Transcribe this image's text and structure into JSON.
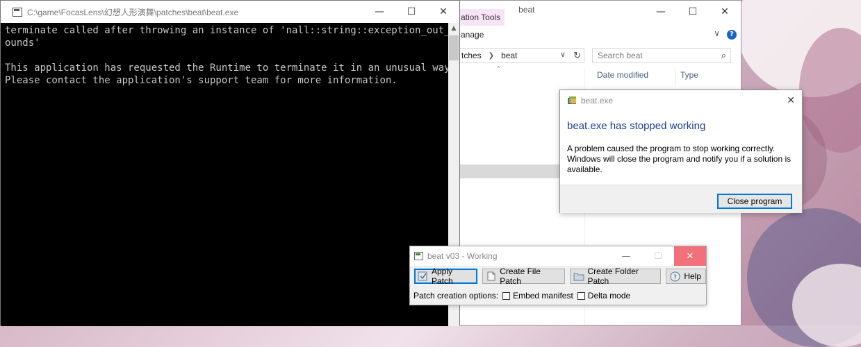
{
  "console": {
    "title": "C:\\game\\FocasLens\\幻想人形演舞\\patches\\beat\\beat.exe",
    "output_text": "terminate called after throwing an instance of 'nall::string::exception_out_of_b\nounds'\n\nThis application has requested the Runtime to terminate it in an unusual way.\nPlease contact the application's support team for more information."
  },
  "explorer": {
    "title": "beat",
    "app_tools_tab": "ation Tools",
    "manage_tab": "anage",
    "breadcrumb": [
      "tches",
      "beat"
    ],
    "search_placeholder": "Search beat",
    "columns": [
      "Date modified",
      "Type"
    ]
  },
  "crash_dialog": {
    "title": "beat.exe",
    "heading": "beat.exe has stopped working",
    "message": "A problem caused the program to stop working correctly. Windows will close the program and notify you if a solution is available.",
    "button": "Close program"
  },
  "beat_window": {
    "title": "beat v03 - Working",
    "buttons": {
      "apply": "Apply Patch",
      "create_file": "Create File Patch",
      "create_folder": "Create Folder Patch",
      "help": "Help"
    },
    "options_label": "Patch creation options:",
    "embed_manifest": "Embed manifest",
    "delta_mode": "Delta mode"
  },
  "icons": {
    "minimize": "minimize-icon",
    "maximize": "maximize-icon",
    "close": "close-icon",
    "help": "help-icon",
    "search": "search-icon",
    "refresh": "refresh-icon"
  },
  "colors": {
    "dialog_heading": "#1c3f94",
    "default_button_border": "#0078d7",
    "close_hover": "#f1707a",
    "app_tools_tab": "#f7e4f7"
  }
}
